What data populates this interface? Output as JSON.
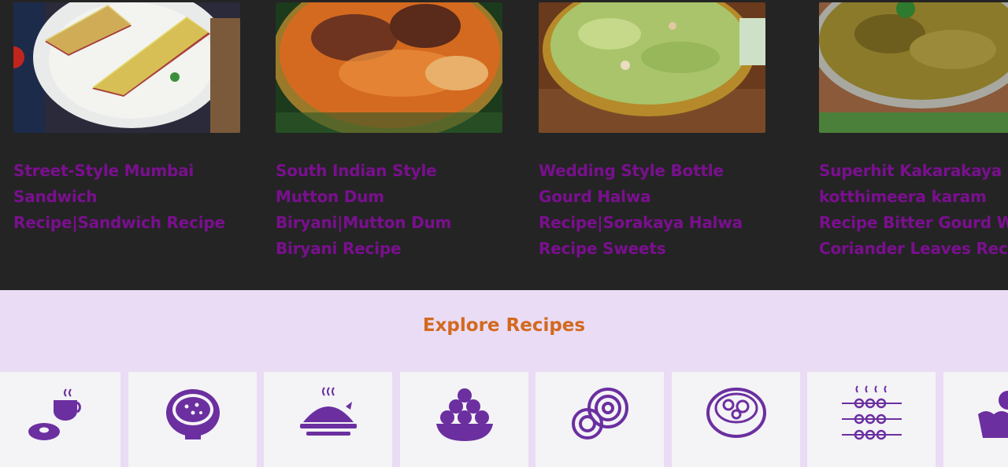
{
  "recipes": [
    {
      "title": "Street-Style Mumbai Sandwich Recipe|Sandwich Recipe",
      "image": "sandwich-photo"
    },
    {
      "title": "South Indian Style Mutton Dum Biryani|Mutton Dum Biryani Recipe",
      "image": "biryani-photo"
    },
    {
      "title": "Wedding Style Bottle Gourd Halwa Recipe|Sorakaya Halwa Recipe Sweets",
      "image": "halwa-photo"
    },
    {
      "title": "Superhit Kakarakaya kotthimeera karam Recipe Bitter Gourd With Coriander Leaves Recipe",
      "image": "kakarakaya-photo"
    }
  ],
  "explore": {
    "heading": "Explore Recipes",
    "categories": [
      {
        "icon": "coffee-donut-icon"
      },
      {
        "icon": "curry-bowl-icon"
      },
      {
        "icon": "rice-plate-icon"
      },
      {
        "icon": "laddu-sweets-icon"
      },
      {
        "icon": "jalebi-murukku-icon"
      },
      {
        "icon": "soup-bowl-icon"
      },
      {
        "icon": "kebab-skewers-icon"
      },
      {
        "icon": "dessert-cup-icon"
      }
    ]
  },
  "colors": {
    "title": "#7a0f8f",
    "heading": "#d2691e",
    "icon": "#6b2fa0",
    "explore_bg": "#eadcf5"
  }
}
